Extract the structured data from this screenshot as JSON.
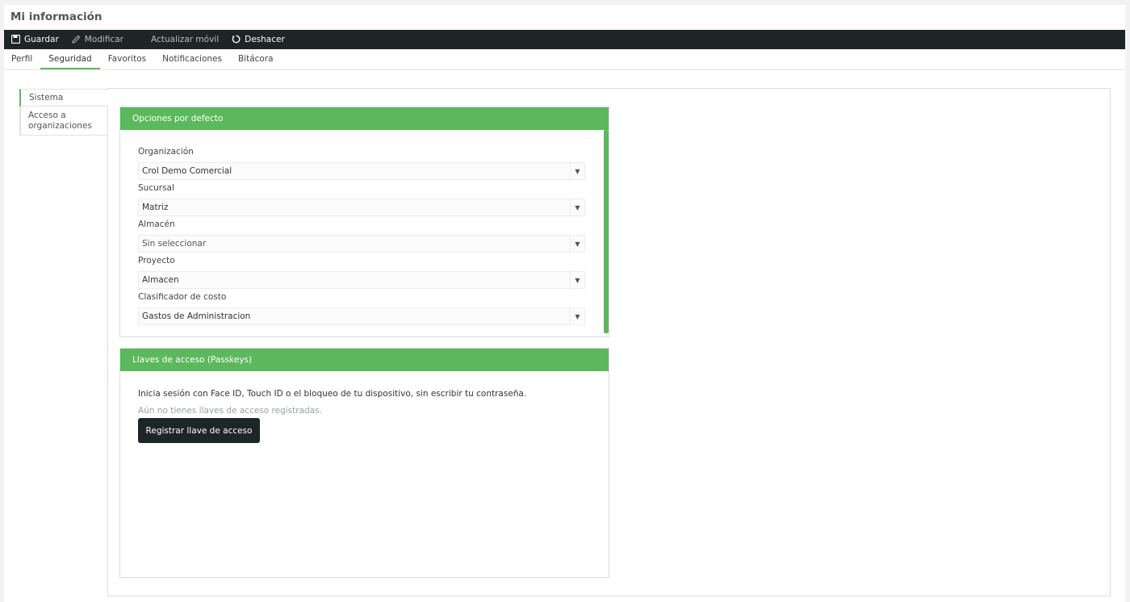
{
  "page": {
    "title": "Mi información"
  },
  "toolbar": {
    "save_label": "Guardar",
    "edit_label": "Modificar",
    "update_label": "Actualizar móvil",
    "undo_label": "Deshacer"
  },
  "tabs": [
    {
      "label": "Perfil"
    },
    {
      "label": "Seguridad"
    },
    {
      "label": "Favoritos"
    },
    {
      "label": "Notificaciones"
    },
    {
      "label": "Bitácora"
    }
  ],
  "side_nav": {
    "items": [
      {
        "label": "Sistema"
      },
      {
        "label": "Acceso a organizaciones"
      }
    ]
  },
  "defaults_panel": {
    "title": "Opciones por defecto",
    "fields": [
      {
        "label": "Organización",
        "value": "Crol Demo Comercial"
      },
      {
        "label": "Sucursal",
        "value": "Matriz"
      },
      {
        "label": "Almacén",
        "value": "Sin seleccionar"
      },
      {
        "label": "Proyecto",
        "value": "Almacen"
      },
      {
        "label": "Clasificador de costo",
        "value": "Gastos de Administracion"
      }
    ]
  },
  "passkeys_panel": {
    "title": "Llaves de acceso (Passkeys)",
    "description": "Inicia sesión con Face ID, Touch ID o el bloqueo de tu dispositivo, sin escribir tu contraseña.",
    "empty_text": "Aún no tienes llaves de acceso registradas.",
    "register_label": "Registrar llave de acceso"
  },
  "colors": {
    "accent": "#5cb85c",
    "toolbar": "#1e2526"
  },
  "icons": {
    "save": "save-icon",
    "edit": "pencil-icon",
    "undo": "undo-icon",
    "dropdown": "chevron-down-icon"
  }
}
